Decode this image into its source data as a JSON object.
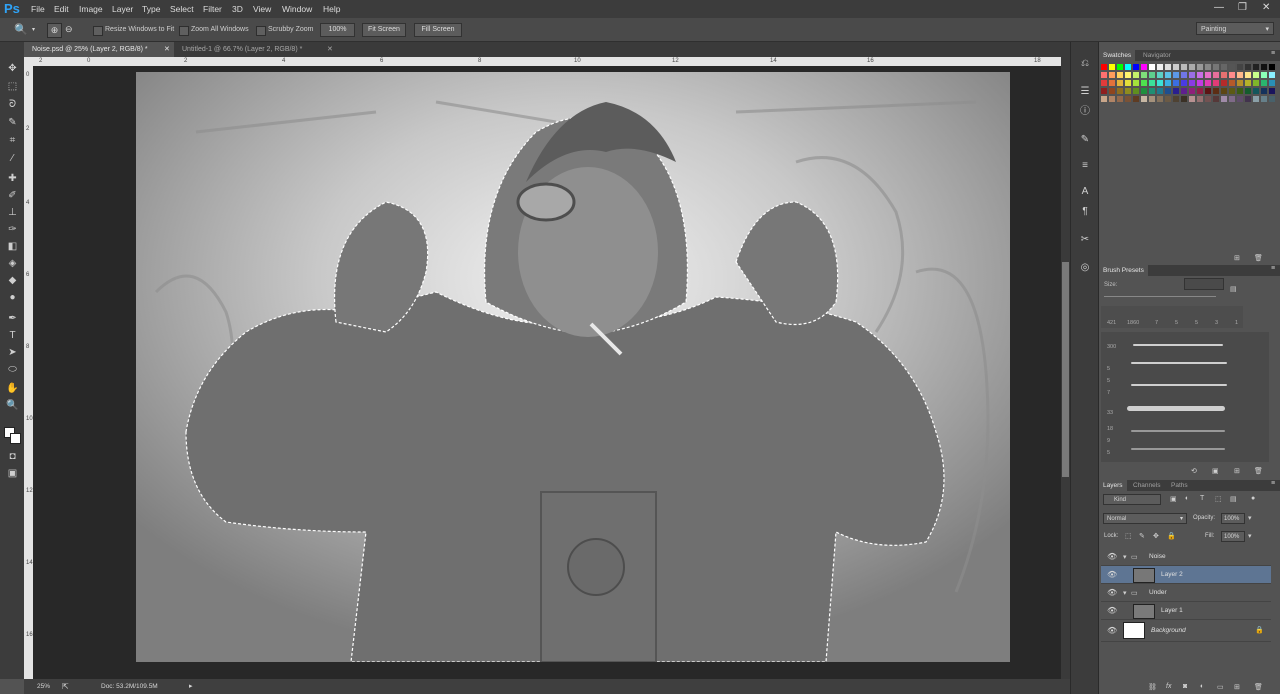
{
  "app": {
    "logo": "Ps"
  },
  "menu": [
    "File",
    "Edit",
    "Image",
    "Layer",
    "Type",
    "Select",
    "Filter",
    "3D",
    "View",
    "Window",
    "Help"
  ],
  "window_controls": {
    "minimize": "—",
    "restore": "❐",
    "close": "✕"
  },
  "options": {
    "resize_windows": "Resize Windows to Fit",
    "zoom_all": "Zoom All Windows",
    "scrubby_zoom": "Scrubby Zoom",
    "zoom_value": "100%",
    "fit_screen": "Fit Screen",
    "fill_screen": "Fill Screen",
    "workspace": "Painting"
  },
  "tabs": [
    {
      "label": "Noise.psd @ 25% (Layer 2, RGB/8) *"
    },
    {
      "label": "Untitled-1 @ 66.7% (Layer 2, RGB/8) *"
    }
  ],
  "ruler_top": [
    "2",
    "0",
    "2",
    "4",
    "6",
    "8",
    "10",
    "12",
    "14",
    "16",
    "18"
  ],
  "ruler_left": [
    "0",
    "2",
    "4",
    "6",
    "8",
    "10",
    "12",
    "14",
    "16"
  ],
  "status": {
    "zoom": "25%",
    "doc": "Doc: 53.2M/109.5M"
  },
  "swatches_panel": {
    "tabs": [
      "Swatches",
      "Navigator"
    ]
  },
  "brush_panel": {
    "title": "Brush Presets",
    "size_label": "Size:",
    "tip_sizes": [
      "421",
      "1860",
      "7",
      "5",
      "5",
      "3",
      "1"
    ],
    "list_sizes": [
      "300",
      "5",
      "5",
      "7",
      "33",
      "18",
      "9",
      "5"
    ]
  },
  "layers_panel": {
    "tabs": [
      "Layers",
      "Channels",
      "Paths"
    ],
    "kind": "Kind",
    "blend_mode": "Normal",
    "opacity_label": "Opacity:",
    "opacity": "100%",
    "lock_label": "Lock:",
    "fill_label": "Fill:",
    "fill": "100%",
    "layers": [
      {
        "name": "Noise",
        "type": "group"
      },
      {
        "name": "Layer 2",
        "type": "layer",
        "selected": true
      },
      {
        "name": "Under",
        "type": "group"
      },
      {
        "name": "Layer 1",
        "type": "layer"
      },
      {
        "name": "Background",
        "type": "background"
      }
    ]
  },
  "colors": {
    "accent": "#2fa3f7",
    "selection": "#5e7593"
  }
}
